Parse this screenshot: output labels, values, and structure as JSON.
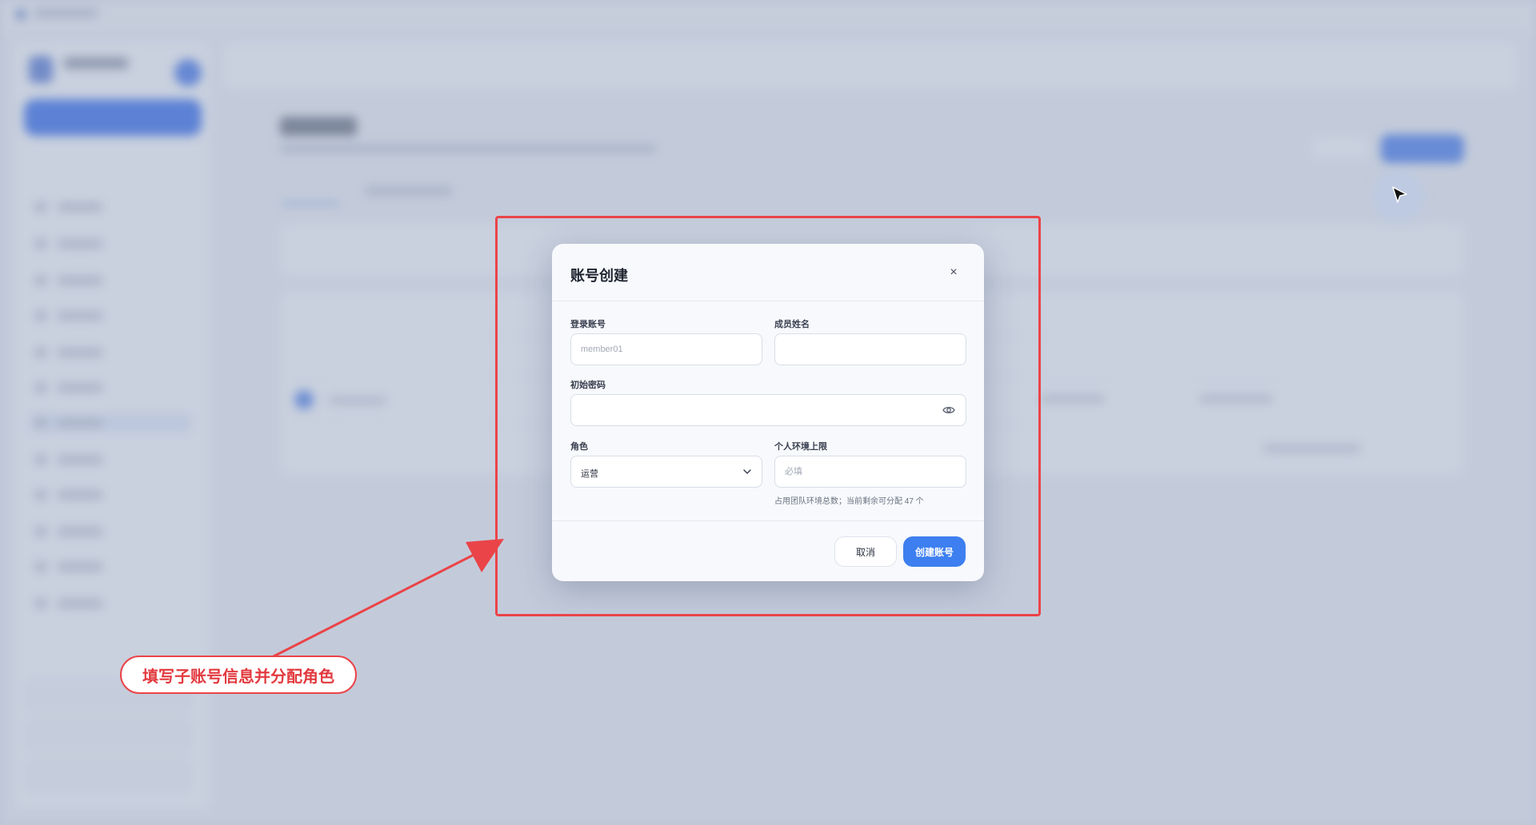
{
  "modal": {
    "title": "账号创建",
    "close_label": "×",
    "login_account": {
      "label": "登录账号",
      "placeholder": "member01",
      "value": ""
    },
    "member_name": {
      "label": "成员姓名",
      "placeholder": "",
      "value": ""
    },
    "initial_password": {
      "label": "初始密码",
      "placeholder": "",
      "value": ""
    },
    "role": {
      "label": "角色",
      "selected": "运营"
    },
    "env_limit": {
      "label": "个人环境上限",
      "placeholder": "必填",
      "value": ""
    },
    "env_hint": "占用团队环境总数；当前剩余可分配 47 个",
    "cancel_label": "取消",
    "submit_label": "创建账号"
  },
  "annotation": {
    "callout_text": "填写子账号信息并分配角色",
    "accent_color": "#ea4448"
  },
  "icons": {
    "password_toggle": "eye-icon",
    "role_dropdown": "chevron-down-icon",
    "cursor": "cursor-icon"
  }
}
